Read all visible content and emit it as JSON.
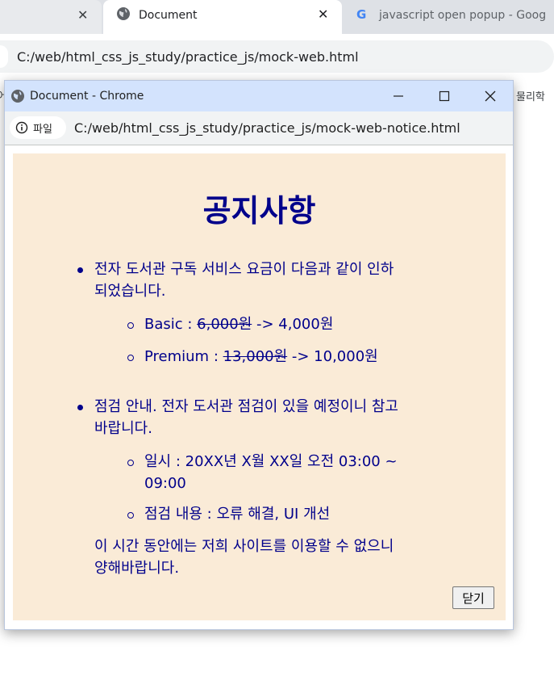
{
  "browser": {
    "tabs": [
      {
        "label": "",
        "close": "✕"
      },
      {
        "label": "Document",
        "close": "✕"
      },
      {
        "label": "javascript open popup - Goog"
      }
    ],
    "address_url": "C:/web/html_css_js_study/practice_js/mock-web.html",
    "bookmark_left": "어",
    "bookmark_right": "물리학"
  },
  "popup": {
    "title": "Document - Chrome",
    "chip_label": "파일",
    "url": "C:/web/html_css_js_study/practice_js/mock-web-notice.html",
    "content": {
      "heading": "공지사항",
      "item1_line1": "전자 도서관 구독 서비스 요금이 다음과 같이 인하",
      "item1_line2": "되었습니다.",
      "basic_label": "Basic : ",
      "basic_old": "6,000원",
      "basic_new": " -> 4,000원",
      "premium_label": "Premium : ",
      "premium_old": "13,000원",
      "premium_new": " -> 10,000원",
      "item2_line1": "점검 안내. 전자 도서관 점검이 있을 예정이니 참고",
      "item2_line2": "바랍니다.",
      "schedule_line1": "일시 : 20XX년 X월 XX일 오전 03:00 ~",
      "schedule_line2": "09:00",
      "maintenance": "점검 내용 : 오류 해결, UI 개선",
      "notice_line1": "이 시간 동안에는 저희 사이트를 이용할 수 없으니",
      "notice_line2": "양해바랍니다.",
      "close_button": "닫기"
    }
  }
}
